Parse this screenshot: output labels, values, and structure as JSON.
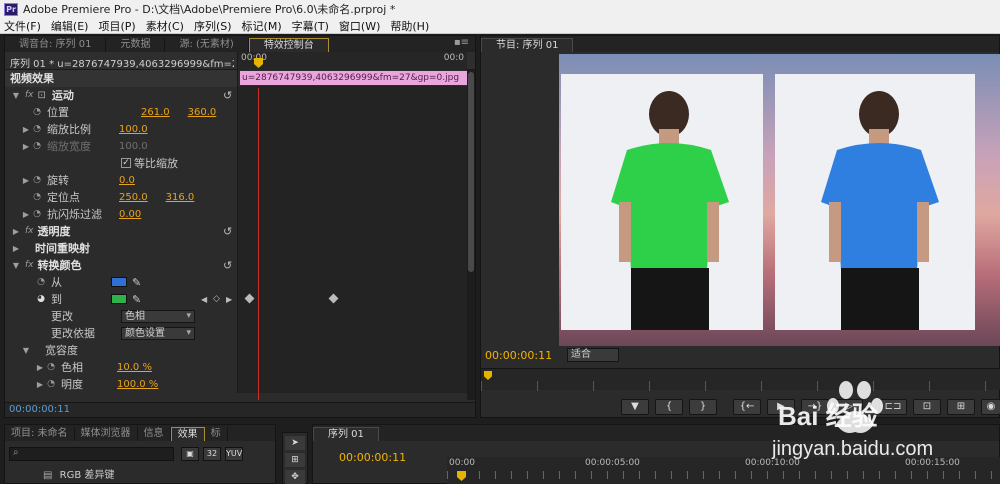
{
  "window": {
    "app_icon": "Pr",
    "title": "Adobe Premiere Pro - D:\\文档\\Adobe\\Premiere Pro\\6.0\\未命名.prproj *"
  },
  "menu": [
    "文件(F)",
    "编辑(E)",
    "项目(P)",
    "素材(C)",
    "序列(S)",
    "标记(M)",
    "字幕(T)",
    "窗口(W)",
    "帮助(H)"
  ],
  "effect_panel": {
    "tabs": [
      "调音台: 序列 01",
      "元数据",
      "源: (无素材)",
      "特效控制台"
    ],
    "active_tab": 3,
    "sequence_label": "序列 01 * u=2876747939,4063296999&fm=27&gp...",
    "timeline_start": "00:00",
    "timeline_end": "00:0",
    "clip_name": "u=2876747939,4063296999&fm=27&gp=0.jpg",
    "section_video": "视频效果",
    "motion": "运动",
    "position_label": "位置",
    "position_x": "261.0",
    "position_y": "360.0",
    "scale_label": "缩放比例",
    "scale": "100.0",
    "scale_width_label": "缩放宽度",
    "scale_width": "100.0",
    "uniform_scale": "等比缩放",
    "rotation_label": "旋转",
    "rotation": "0.0",
    "anchor_label": "定位点",
    "anchor_x": "250.0",
    "anchor_y": "316.0",
    "flicker_label": "抗闪烁过滤",
    "flicker": "0.00",
    "opacity": "透明度",
    "time_remap": "时间重映射",
    "change_color": "转换颜色",
    "from_label": "从",
    "from_color": "#2f6fd6",
    "to_label": "到",
    "to_color": "#2db34a",
    "change_label": "更改",
    "change_value": "色相",
    "change_by_label": "更改依据",
    "change_by_value": "颜色设置",
    "tolerance": "宽容度",
    "hue_label": "色相",
    "hue_value": "10.0 %",
    "brightness_label": "明度",
    "brightness_value": "100.0 %",
    "footer_tc": "00:00:00:11"
  },
  "program_panel": {
    "tab": "节目: 序列 01",
    "timecode": "00:00:00:11",
    "zoom": "适合",
    "left_shirt_color": "#2ed04a",
    "right_shirt_color": "#2f7fe0",
    "controls": [
      "▼",
      "{",
      "}",
      "{←",
      "▶",
      "→}",
      "▷",
      "⊏⊐",
      "⊡",
      "⊞",
      "◉"
    ]
  },
  "project_panel": {
    "tabs": [
      "项目: 未命名",
      "媒体浏览器",
      "信息",
      "效果",
      "标"
    ],
    "effect_item": "RGB 差异键"
  },
  "sequence_panel": {
    "tab": "序列 01",
    "timecode": "00:00:00:11",
    "ruler": [
      "00:00",
      "00:00:05:00",
      "00:00:10:00",
      "00:00:15:00"
    ]
  },
  "watermark": {
    "brand": "Bai 经验",
    "url": "jingyan.baidu.com"
  }
}
